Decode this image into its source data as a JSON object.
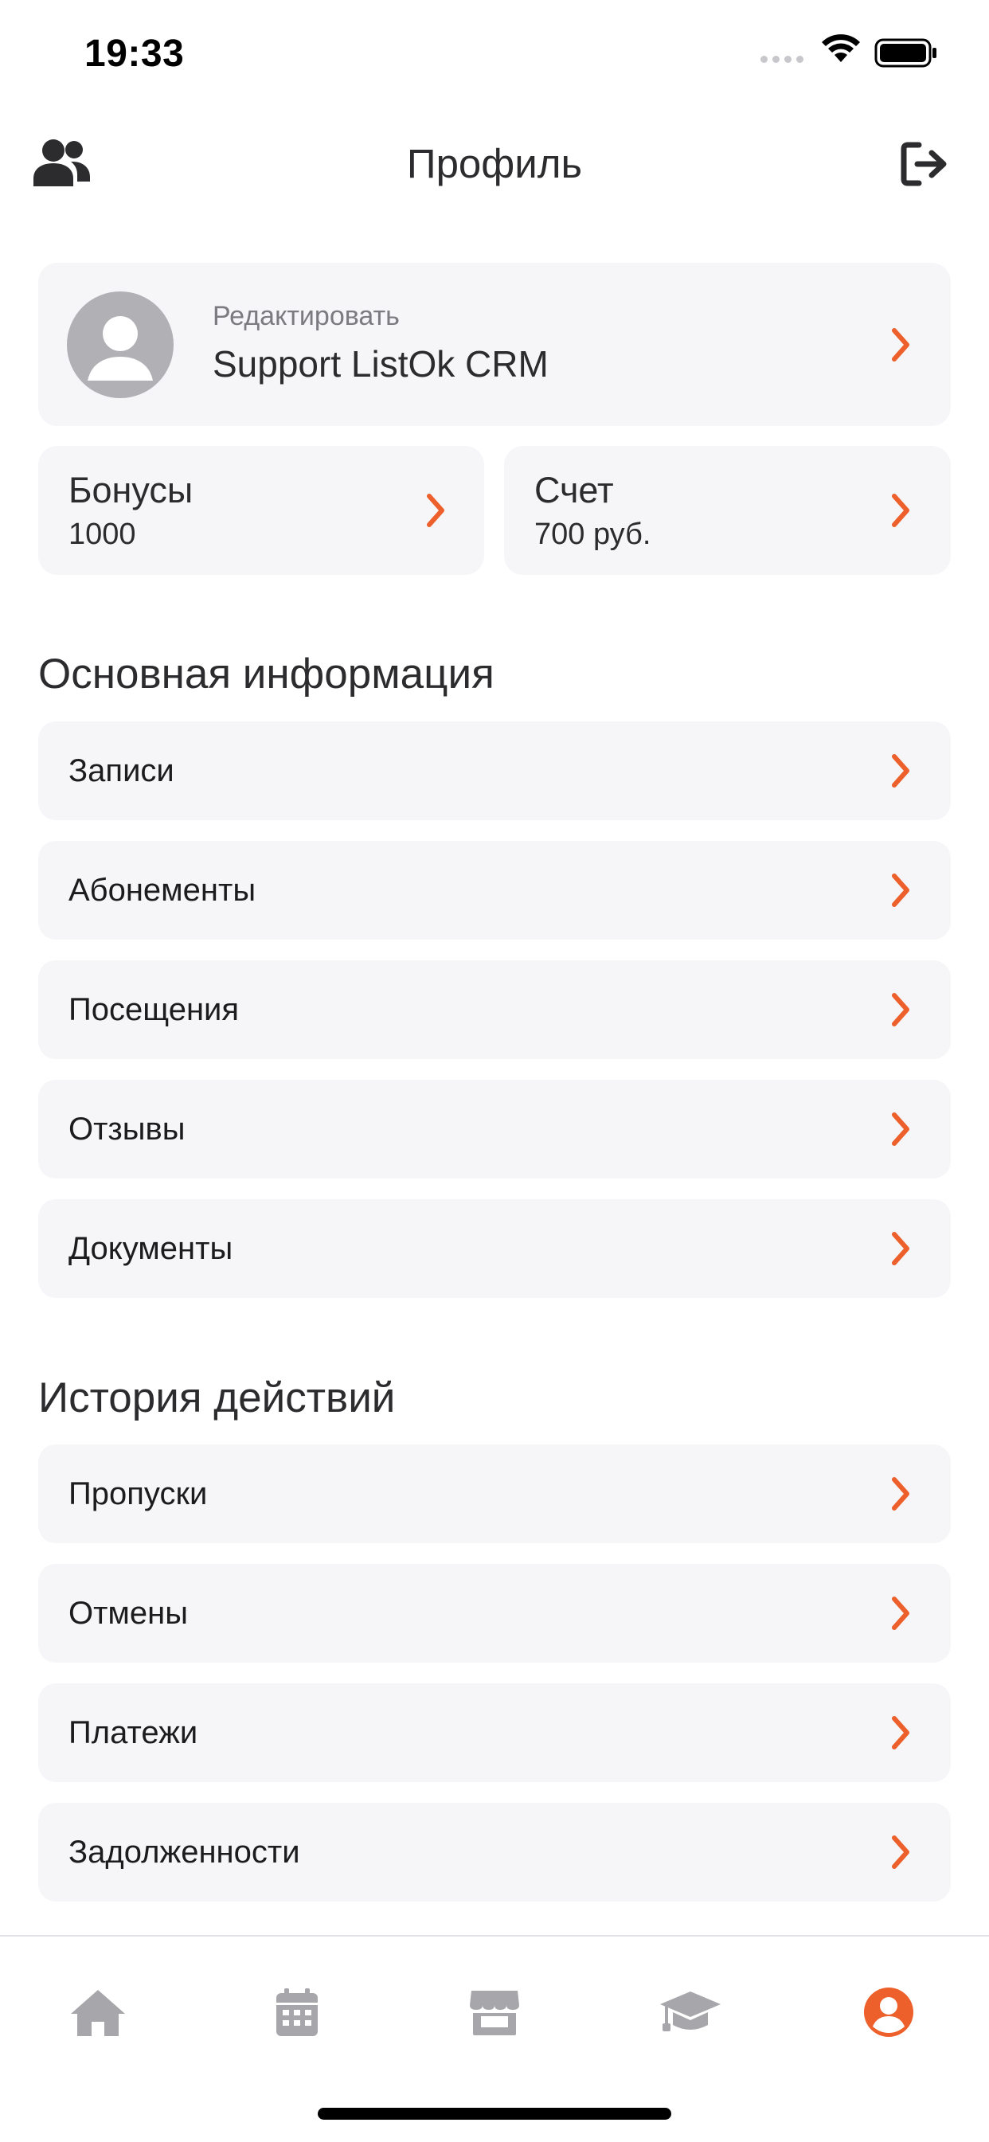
{
  "status_bar": {
    "time": "19:33"
  },
  "header": {
    "title": "Профиль",
    "left_icon": "users-icon",
    "right_icon": "logout-icon"
  },
  "profile": {
    "edit_label": "Редактировать",
    "name": "Support ListOk CRM"
  },
  "bonuses": {
    "title": "Бонусы",
    "value": "1000"
  },
  "account": {
    "title": "Счет",
    "value": "700 руб."
  },
  "main_info": {
    "title": "Основная информация",
    "items": [
      {
        "label": "Записи"
      },
      {
        "label": "Абонементы"
      },
      {
        "label": "Посещения"
      },
      {
        "label": "Отзывы"
      },
      {
        "label": "Документы"
      }
    ]
  },
  "history": {
    "title": "История действий",
    "items": [
      {
        "label": "Пропуски"
      },
      {
        "label": "Отмены"
      },
      {
        "label": "Платежи"
      },
      {
        "label": "Задолженности"
      }
    ]
  },
  "tabbar": {
    "tabs": [
      {
        "icon": "home-icon",
        "active": false
      },
      {
        "icon": "calendar-icon",
        "active": false
      },
      {
        "icon": "store-icon",
        "active": false
      },
      {
        "icon": "graduation-cap-icon",
        "active": false
      },
      {
        "icon": "profile-icon",
        "active": true
      }
    ]
  },
  "colors": {
    "accent": "#ed5f2b",
    "card_bg": "#f6f6f8",
    "tab_inactive": "#a6a6ab",
    "text": "#2c2c2e"
  }
}
